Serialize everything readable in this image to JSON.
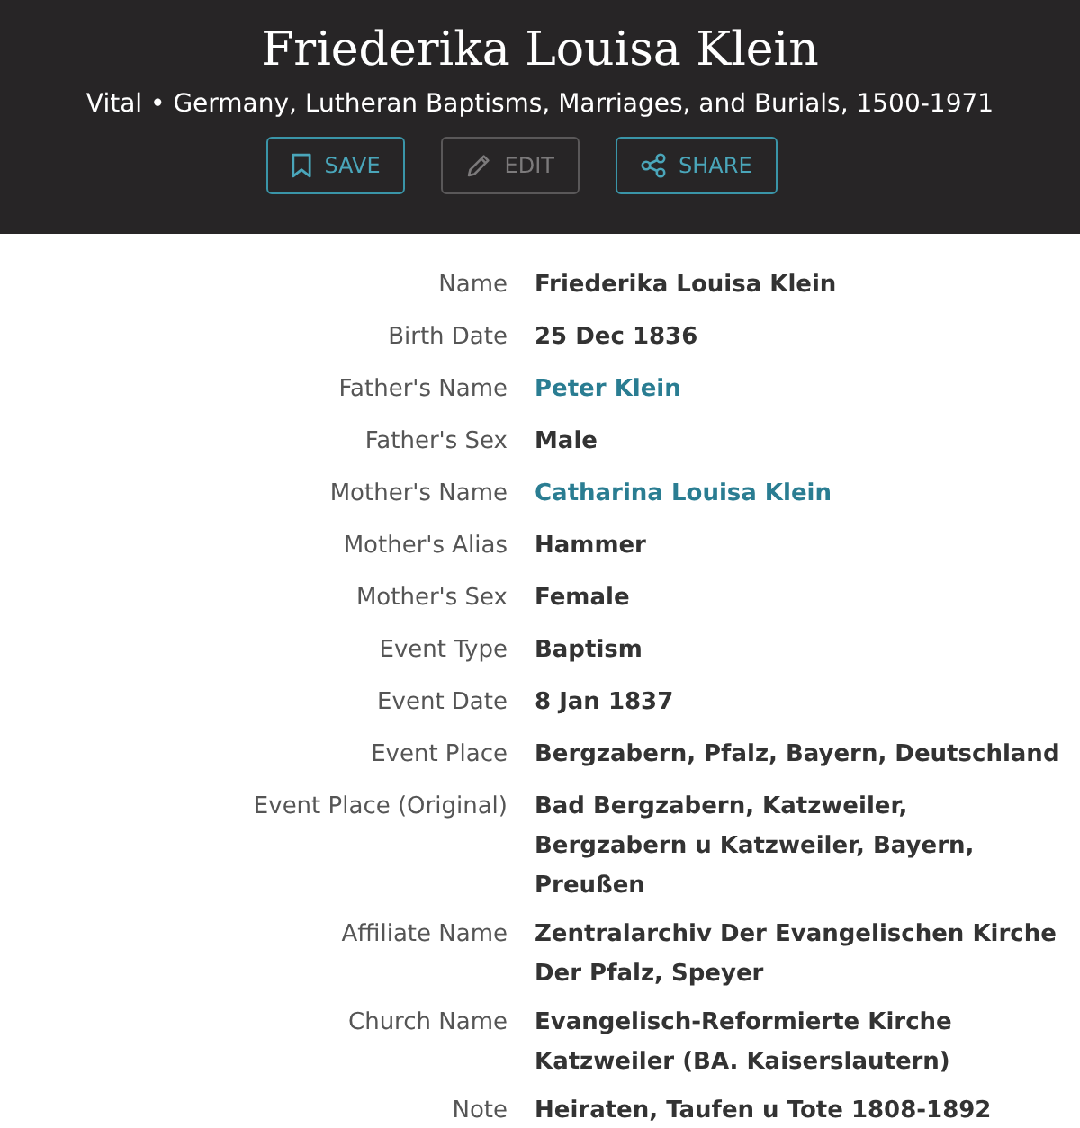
{
  "header": {
    "title": "Friederika Louisa Klein",
    "subtitle": "Vital • Germany, Lutheran Baptisms, Marriages, and Burials, 1500-1971",
    "buttons": [
      {
        "kind": "save",
        "label": "SAVE",
        "disabled": false
      },
      {
        "kind": "edit",
        "label": "EDIT",
        "disabled": true
      },
      {
        "kind": "share",
        "label": "SHARE",
        "disabled": false
      }
    ]
  },
  "fields": [
    {
      "label": "Name",
      "value": "Friederika Louisa Klein",
      "link": false
    },
    {
      "label": "Birth Date",
      "value": "25 Dec 1836",
      "link": false
    },
    {
      "label": "Father's Name",
      "value": "Peter Klein",
      "link": true
    },
    {
      "label": "Father's Sex",
      "value": "Male",
      "link": false
    },
    {
      "label": "Mother's Name",
      "value": "Catharina Louisa Klein",
      "link": true
    },
    {
      "label": "Mother's Alias",
      "value": "Hammer",
      "link": false
    },
    {
      "label": "Mother's Sex",
      "value": "Female",
      "link": false
    },
    {
      "label": "Event Type",
      "value": "Baptism",
      "link": false
    },
    {
      "label": "Event Date",
      "value": "8 Jan 1837",
      "link": false
    },
    {
      "label": "Event Place",
      "value": "Bergzabern, Pfalz, Bayern, Deutschland",
      "link": false
    },
    {
      "label": "Event Place (Original)",
      "value": "Bad Bergzabern, Katzweiler,\nBergzabern u Katzweiler, Bayern,\nPreußen",
      "link": false
    },
    {
      "label": "Affiliate Name",
      "value": "Zentralarchiv Der Evangelischen Kirche Der Pfalz, Speyer",
      "link": false
    },
    {
      "label": "Church Name",
      "value": "Evangelisch-Reformierte Kirche Katzweiler (BA. Kaiserslautern)",
      "link": false
    },
    {
      "label": "Note",
      "value": "Heiraten, Taufen u Tote 1808-1892",
      "link": false
    }
  ]
}
